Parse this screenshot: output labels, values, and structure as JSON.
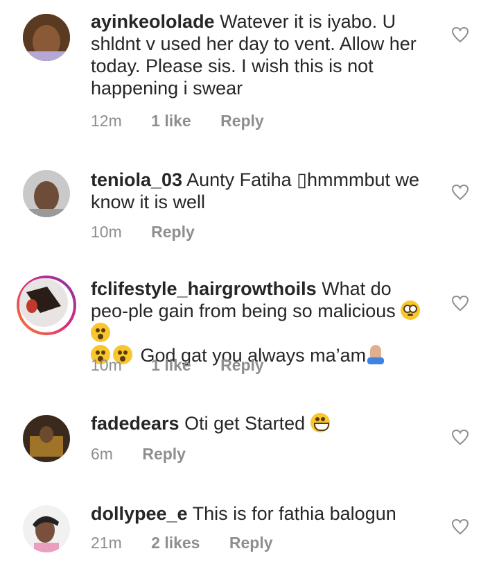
{
  "comments": [
    {
      "username": "ayinkeololade",
      "text": "Watever it is iyabo. U shldnt v used her day to vent. Allow her today. Please sis. I wish this is not happening i swear",
      "time": "12m",
      "likes": "1 like",
      "reply": "Reply"
    },
    {
      "username": "teniola_03",
      "text": "Aunty Fatiha ▯​hmmmbut we know it is well",
      "time": "10m",
      "reply": "Reply"
    },
    {
      "username": "fclifestyle_hairgrowthoils",
      "text_a": "What do peo-ple gain from being so malicious",
      "text_b": "God gat you always ma’am",
      "time": "10m",
      "likes": "1 like",
      "reply": "Reply"
    },
    {
      "username": "fadedears",
      "text": "Oti get Started",
      "time": "6m",
      "reply": "Reply"
    },
    {
      "username": "dollypee_e",
      "text": "This is for fathia balogun",
      "time": "21m",
      "likes": "2 likes",
      "reply": "Reply"
    }
  ],
  "icons": {
    "like": "heart-outline-icon",
    "emoji_flushed": "flushed-face-emoji",
    "emoji_hushed": "hushed-face-emoji",
    "emoji_grin": "grinning-face-emoji",
    "emoji_pray": "folded-hands-emoji"
  },
  "colors": {
    "text": "#262626",
    "meta": "#8e8e8e"
  }
}
